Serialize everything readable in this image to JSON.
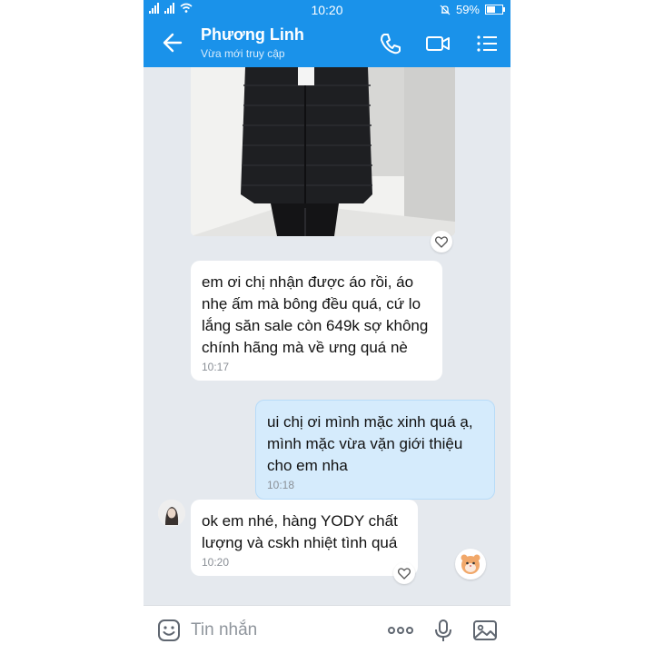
{
  "status_bar": {
    "time": "10:20",
    "battery": "59%",
    "battery_level": 0.59,
    "icons": [
      "signal-icon",
      "wifi-icon",
      "alarm-icon",
      "battery-icon"
    ]
  },
  "header": {
    "contact_name": "Phương Linh",
    "status": "Vừa mới truy cập",
    "icons": [
      "back-arrow-icon",
      "phone-icon",
      "video-camera-icon",
      "menu-list-icon"
    ]
  },
  "messages": [
    {
      "direction": "incoming",
      "text": "em ơi chị nhận được áo rồi, áo nhẹ ấm mà bông đều quá, cứ lo lắng săn sale còn 649k sợ không chính hãng mà về ưng quá nè",
      "time": "10:17"
    },
    {
      "direction": "outgoing",
      "text": "ui chị ơi mình mặc xinh quá ạ, mình mặc vừa vặn giới thiệu cho em nha",
      "time": "10:18"
    },
    {
      "direction": "incoming",
      "text": "ok em nhé, hàng YODY  chất lượng và cskh nhiệt tình quá",
      "time": "10:20"
    }
  ],
  "input_bar": {
    "placeholder": "Tin nhắn",
    "icons": [
      "emoji-icon",
      "more-dots-icon",
      "microphone-icon",
      "image-icon"
    ]
  },
  "colors": {
    "accent": "#1a92ea",
    "chat_background": "#e5e9ee",
    "incoming_bubble": "#ffffff",
    "outgoing_bubble": "#d5ebfc"
  }
}
